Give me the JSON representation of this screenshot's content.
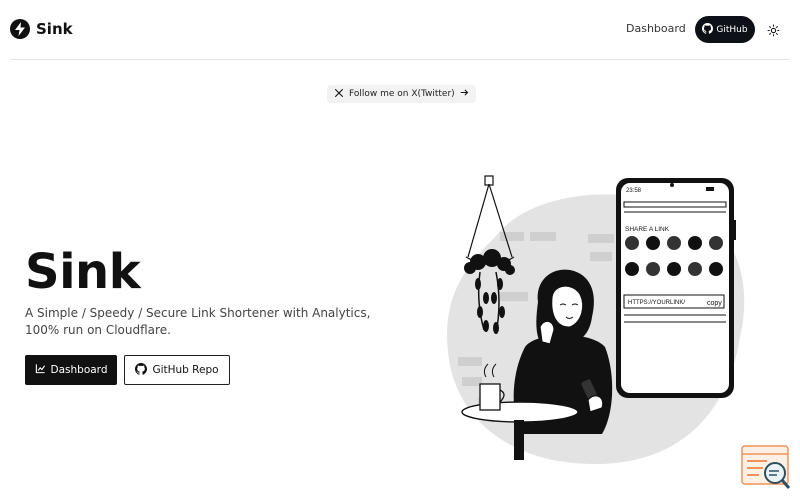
{
  "nav": {
    "brand": "Sink",
    "links": {
      "dashboard": "Dashboard",
      "github": "GitHub"
    }
  },
  "announcement": {
    "text": "Follow me on X(Twitter)"
  },
  "hero": {
    "title": "Sink",
    "description": "A Simple / Speedy / Secure Link Shortener with Analytics, 100% run on Cloudflare.",
    "primary_button": "Dashboard",
    "secondary_button": "GitHub Repo"
  },
  "illustration": {
    "phone_time": "23:58",
    "share_label": "SHARE A LINK",
    "url_text": "HTTPS://YOURLINK/",
    "copy_text": "copy"
  },
  "colors": {
    "primary": "#111111",
    "github": "#0d1117",
    "blob": "#e3e3e3",
    "widget": "#f2925b"
  }
}
